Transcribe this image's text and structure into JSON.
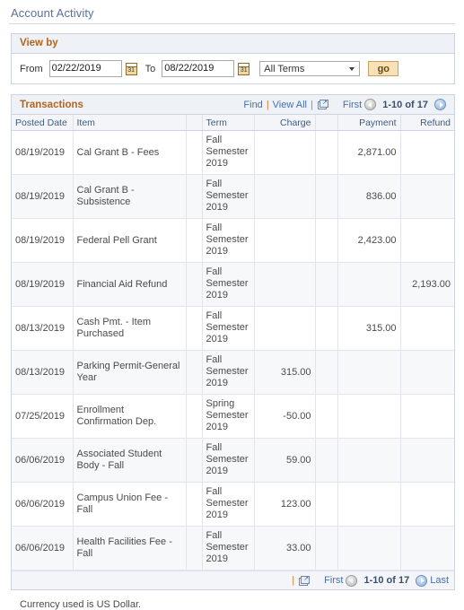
{
  "page": {
    "title": "Account Activity",
    "currency_note": "Currency used is US Dollar."
  },
  "view_by": {
    "header": "View by",
    "from_label": "From",
    "from_value": "02/22/2019",
    "to_label": "To",
    "to_value": "08/22/2019",
    "term_selected": "All Terms",
    "term_options": [
      "All Terms"
    ],
    "go_label": "go",
    "calendar_icon": "calendar-icon",
    "accent_orange": "#b4641e",
    "go_bg": "#f7e2b8"
  },
  "grid": {
    "title": "Transactions",
    "find_label": "Find",
    "view_all_label": "View All",
    "separator": "|",
    "expand_icon": "new-window-icon",
    "pager_top": {
      "first_label": "First",
      "count_label": "1-10 of 17",
      "prev_icon": "prev-arrow-icon",
      "next_icon": "next-arrow-icon"
    },
    "pager_bottom": {
      "separator": "|",
      "expand_icon": "new-window-icon",
      "first_label": "First",
      "count_label": "1-10 of 17",
      "last_label": "Last",
      "prev_icon": "prev-arrow-icon",
      "next_icon": "next-arrow-icon"
    },
    "columns": [
      {
        "key": "posted_date",
        "label": "Posted Date",
        "align": "left"
      },
      {
        "key": "item",
        "label": "Item",
        "align": "left"
      },
      {
        "key": "spacer1",
        "label": "",
        "align": "left"
      },
      {
        "key": "term",
        "label": "Term",
        "align": "left"
      },
      {
        "key": "charge",
        "label": "Charge",
        "align": "right"
      },
      {
        "key": "spacer2",
        "label": "",
        "align": "left"
      },
      {
        "key": "payment",
        "label": "Payment",
        "align": "right"
      },
      {
        "key": "refund",
        "label": "Refund",
        "align": "right"
      }
    ],
    "rows": [
      {
        "posted_date": "08/19/2019",
        "item": "Cal Grant B - Fees",
        "term": "Fall Semester 2019",
        "charge": "",
        "payment": "2,871.00",
        "refund": ""
      },
      {
        "posted_date": "08/19/2019",
        "item": "Cal Grant B - Subsistence",
        "term": "Fall Semester 2019",
        "charge": "",
        "payment": "836.00",
        "refund": ""
      },
      {
        "posted_date": "08/19/2019",
        "item": "Federal Pell Grant",
        "term": "Fall Semester 2019",
        "charge": "",
        "payment": "2,423.00",
        "refund": ""
      },
      {
        "posted_date": "08/19/2019",
        "item": "Financial Aid Refund",
        "term": "Fall Semester 2019",
        "charge": "",
        "payment": "",
        "refund": "2,193.00"
      },
      {
        "posted_date": "08/13/2019",
        "item": "Cash Pmt. - Item Purchased",
        "term": "Fall Semester 2019",
        "charge": "",
        "payment": "315.00",
        "refund": ""
      },
      {
        "posted_date": "08/13/2019",
        "item": "Parking Permit-General Year",
        "term": "Fall Semester 2019",
        "charge": "315.00",
        "payment": "",
        "refund": ""
      },
      {
        "posted_date": "07/25/2019",
        "item": "Enrollment Confirmation Dep.",
        "term": "Spring Semester 2019",
        "charge": "-50.00",
        "payment": "",
        "refund": ""
      },
      {
        "posted_date": "06/06/2019",
        "item": "Associated Student Body - Fall",
        "term": "Fall Semester 2019",
        "charge": "59.00",
        "payment": "",
        "refund": ""
      },
      {
        "posted_date": "06/06/2019",
        "item": "Campus Union Fee - Fall",
        "term": "Fall Semester 2019",
        "charge": "123.00",
        "payment": "",
        "refund": ""
      },
      {
        "posted_date": "06/06/2019",
        "item": "Health Facilities Fee - Fall",
        "term": "Fall Semester 2019",
        "charge": "33.00",
        "payment": "",
        "refund": ""
      }
    ]
  }
}
